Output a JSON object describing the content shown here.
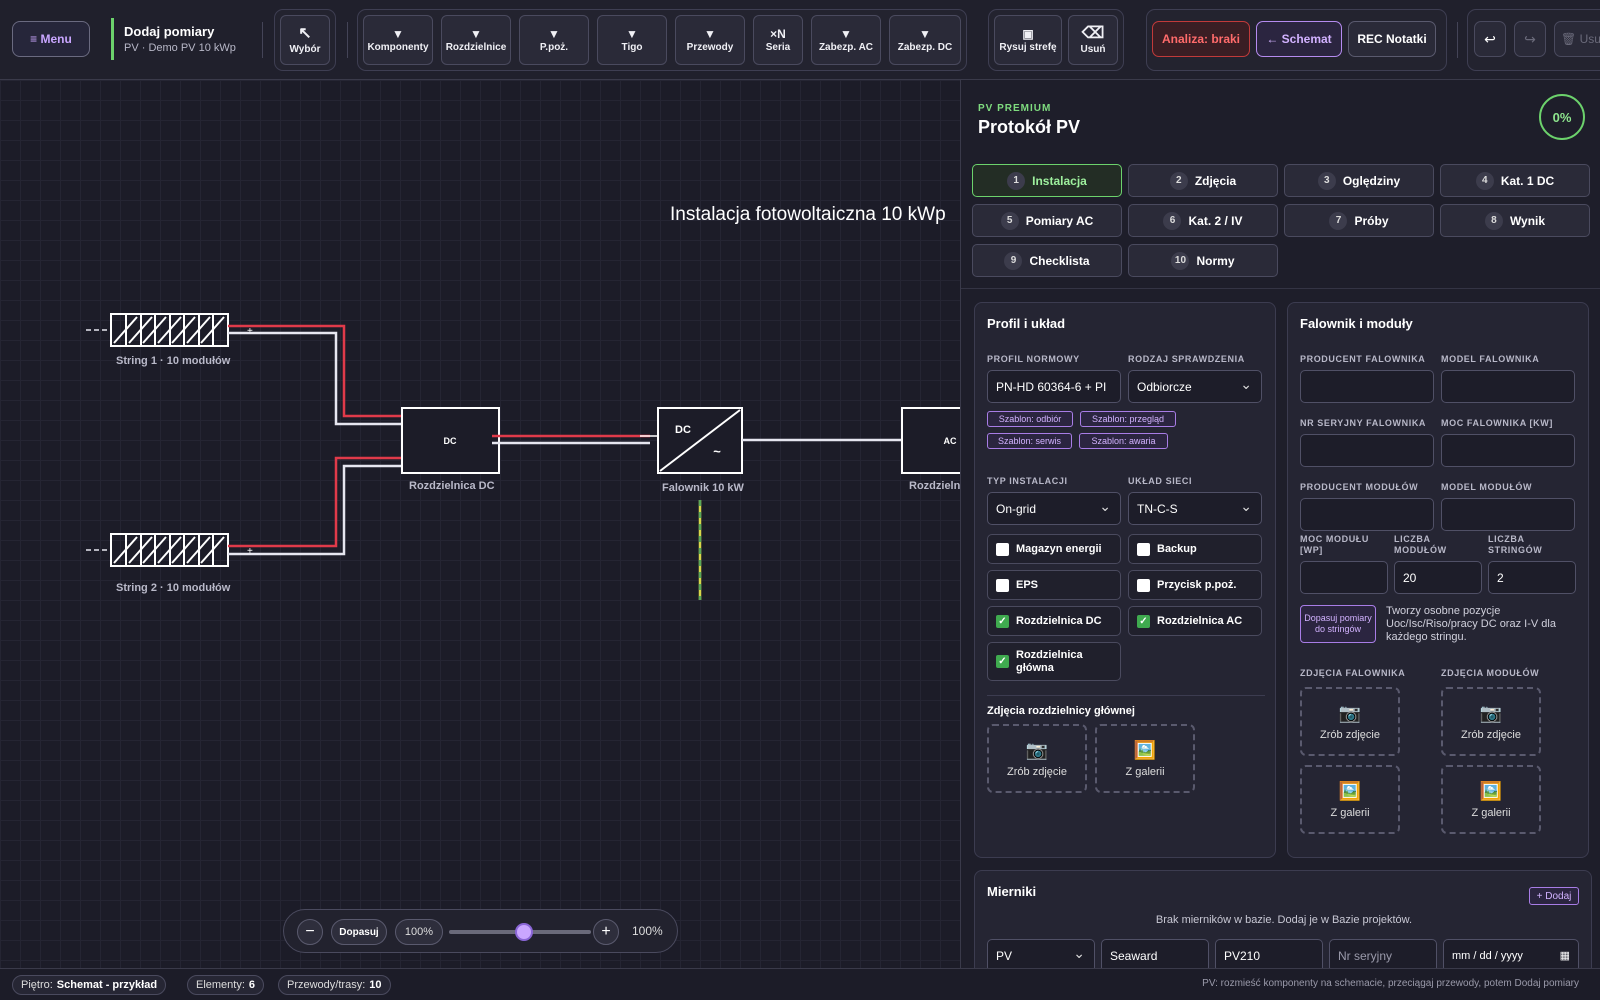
{
  "toolbar": {
    "menu_label": "≡ Menu",
    "project_title": "Dodaj pomiary",
    "project_subtitle": "PV · Demo PV 10 kWp",
    "select_tool": {
      "icon": "↖",
      "label": "Wybór"
    },
    "component_tools": [
      {
        "icon": "▼",
        "label": "Komponenty"
      },
      {
        "icon": "▼",
        "label": "Rozdzielnice"
      },
      {
        "icon": "▼",
        "label": "P.poż."
      },
      {
        "icon": "▼",
        "label": "Tigo"
      },
      {
        "icon": "▼",
        "label": "Przewody"
      },
      {
        "icon": "×N",
        "label": "Seria"
      },
      {
        "icon": "▼",
        "label": "Zabezp. AC"
      },
      {
        "icon": "▼",
        "label": "Zabezp. DC"
      }
    ],
    "draw_zone": {
      "icon": "▣",
      "label": "Rysuj strefę"
    },
    "delete": {
      "icon": "⌫",
      "label": "Usuń"
    },
    "analysis_label": "Analiza: braki",
    "schema_label": "← Schemat",
    "rec_label": "REC Notatki",
    "undo_icon": "↩",
    "redo_icon": "↪",
    "trash_label": "🗑 Usu"
  },
  "canvas": {
    "diagram_title": "Instalacja fotowoltaiczna 10 kWp",
    "string1_label": "String 1 · 10 modułów",
    "string2_label": "String 2 · 10 modułów",
    "dc_box_text": "DC",
    "dc_box_label": "Rozdzielnica DC",
    "inverter_dc_text": "DC",
    "inverter_ac_text": "~",
    "inverter_label": "Falownik 10 kW",
    "ac_box_text": "AC",
    "ac_box_label": "Rozdzielni",
    "plus_sign": "+",
    "zoom": {
      "minus": "−",
      "fit": "Dopasuj",
      "pct": "100%",
      "plus": "+",
      "value": "100%",
      "slider_fraction": 0.5
    }
  },
  "panel": {
    "premium_label": "PV PREMIUM",
    "title": "Protokół PV",
    "progress": "0%",
    "tabs": [
      {
        "n": "1",
        "label": "Instalacja",
        "active": true
      },
      {
        "n": "2",
        "label": "Zdjęcia"
      },
      {
        "n": "3",
        "label": "Oględziny"
      },
      {
        "n": "4",
        "label": "Kat. 1 DC"
      },
      {
        "n": "5",
        "label": "Pomiary AC"
      },
      {
        "n": "6",
        "label": "Kat. 2 / IV"
      },
      {
        "n": "7",
        "label": "Próby"
      },
      {
        "n": "8",
        "label": "Wynik"
      },
      {
        "n": "9",
        "label": "Checklista"
      },
      {
        "n": "10",
        "label": "Normy"
      }
    ],
    "profile": {
      "title": "Profil i układ",
      "norm_label": "PROFIL NORMOWY",
      "norm_value": "PN-HD 60364-6 + PI",
      "check_label": "RODZAJ SPRAWDZENIA",
      "check_value": "Odbiorcze",
      "templates": [
        "Szablon: odbiór",
        "Szablon: przegląd",
        "Szablon: serwis",
        "Szablon: awaria"
      ],
      "install_type_label": "TYP INSTALACJI",
      "install_type_value": "On-grid",
      "grid_label": "UKŁAD SIECI",
      "grid_value": "TN-C-S",
      "checkboxes": [
        {
          "label": "Magazyn energii",
          "checked": false
        },
        {
          "label": "Backup",
          "checked": false
        },
        {
          "label": "EPS",
          "checked": false
        },
        {
          "label": "Przycisk p.poż.",
          "checked": false
        },
        {
          "label": "Rozdzielnica DC",
          "checked": true
        },
        {
          "label": "Rozdzielnica AC",
          "checked": true
        },
        {
          "label": "Rozdzielnica główna",
          "checked": true
        }
      ],
      "photos_title": "Zdjęcia rozdzielnicy głównej",
      "photo_camera": "Zrób zdjęcie",
      "photo_gallery": "Z galerii"
    },
    "inverter": {
      "title": "Falownik i moduły",
      "inv_maker_label": "PRODUCENT FALOWNIKA",
      "inv_model_label": "MODEL FALOWNIKA",
      "inv_serial_label": "NR SERYJNY FALOWNIKA",
      "inv_power_label": "MOC FALOWNIKA [KW]",
      "mod_maker_label": "PRODUCENT MODUŁÓW",
      "mod_model_label": "MODEL MODUŁÓW",
      "mod_power_label": "MOC MODUŁU [WP]",
      "mod_count_label": "LICZBA MODUŁÓW",
      "mod_count_value": "20",
      "string_count_label": "LICZBA STRINGÓW",
      "string_count_value": "2",
      "fit_button": "Dopasuj pomiary do stringów",
      "fit_note": "Tworzy osobne pozycje Uoc/Isc/Riso/pracy DC oraz I-V dla każdego stringu.",
      "inv_photos_label": "ZDJĘCIA FALOWNIKA",
      "mod_photos_label": "ZDJĘCIA MODUŁÓW",
      "photo_camera": "Zrób zdjęcie",
      "photo_gallery": "Z galerii"
    },
    "meters": {
      "title": "Mierniki",
      "add_label": "+ Dodaj",
      "empty_text": "Brak mierników w bazie. Dodaj je w Bazie projektów.",
      "type_value": "PV",
      "maker_value": "Seaward",
      "model_value": "PV210",
      "serial_placeholder": "Nr seryjny",
      "date_placeholder": "mm / dd / yyyy"
    }
  },
  "status": {
    "floor_label": "Piętro:",
    "floor_value": "Schemat - przykład",
    "elements_label": "Elementy:",
    "elements_value": "6",
    "wires_label": "Przewody/trasy:",
    "wires_value": "10",
    "hint": "PV: rozmieść komponenty na schemacie, przeciągaj przewody, potem Dodaj pomiary"
  },
  "colors": {
    "accent": "#c9a6ff",
    "success": "#6cd26c",
    "danger": "#ff6b6b",
    "wire_red": "#e03a4a",
    "wire_white": "#e6e6f0"
  }
}
